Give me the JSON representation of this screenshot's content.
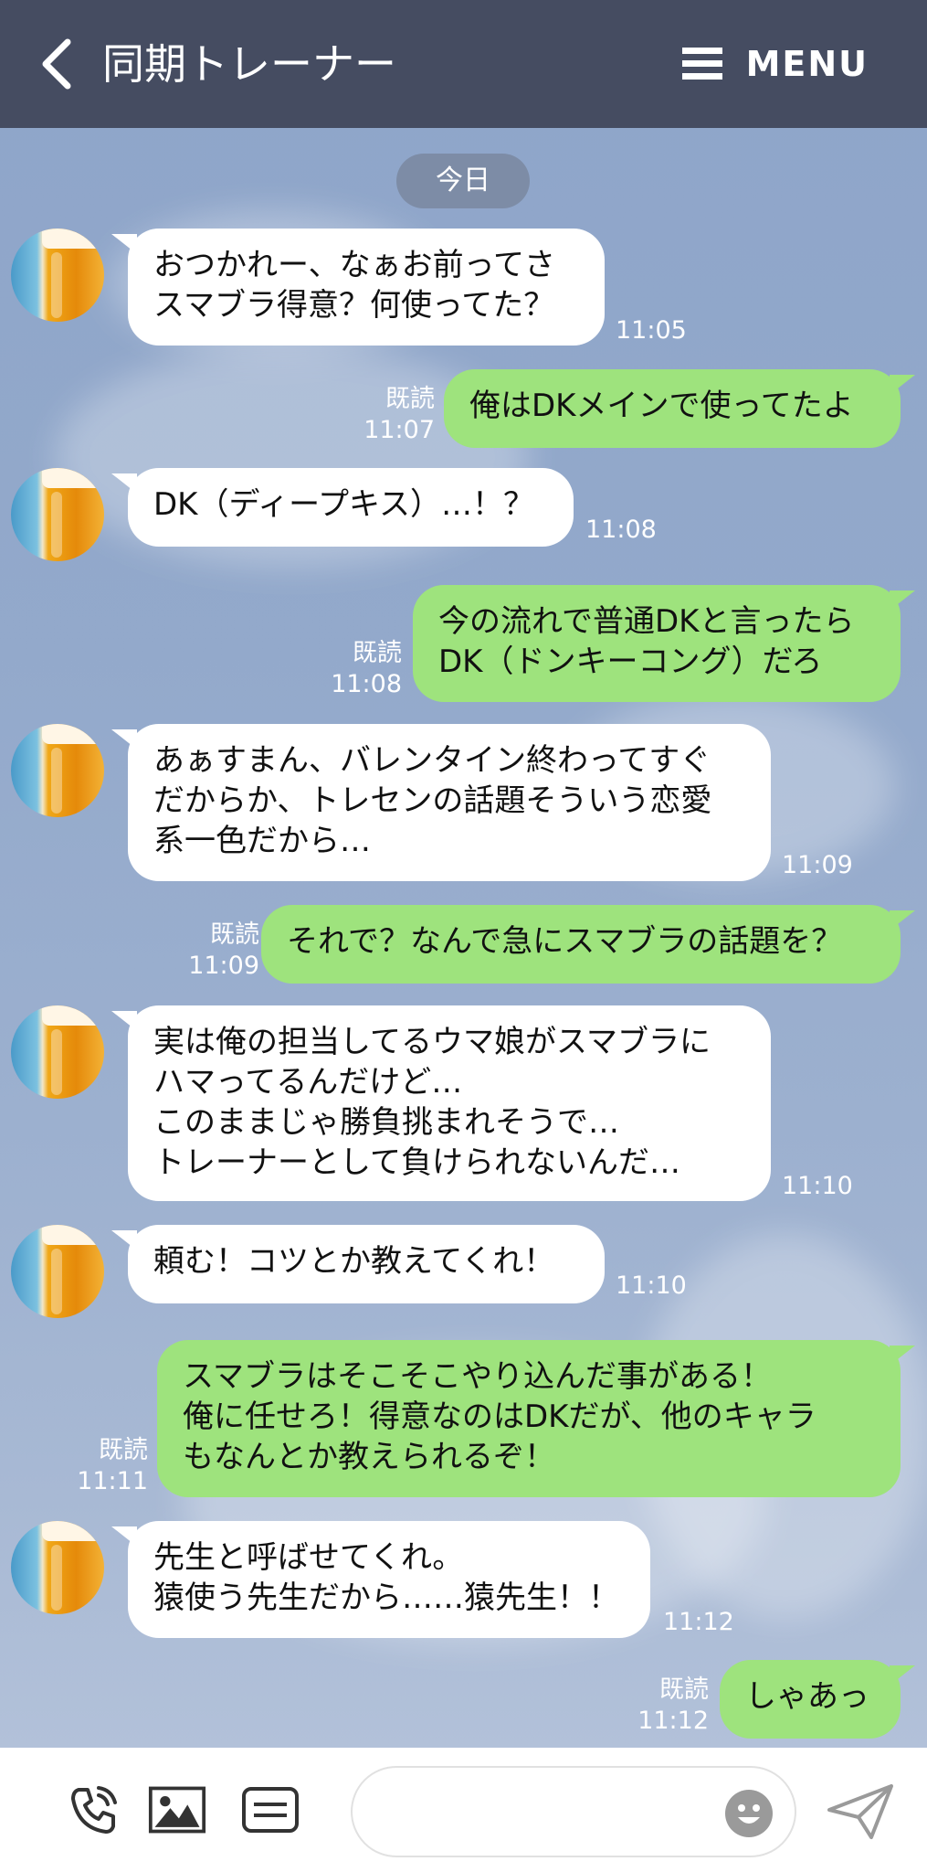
{
  "header": {
    "title": "同期トレーナー",
    "menu_label": "MENU"
  },
  "date_divider": "今日",
  "colors": {
    "header_bg": "#454c61",
    "my_bubble": "#9ee37d",
    "their_bubble": "#ffffff"
  },
  "messages": [
    {
      "from": "them",
      "text": "おつかれー、なぁお前ってさ\nスマブラ得意？何使ってた？",
      "time": "11:05"
    },
    {
      "from": "me",
      "text": "俺はDKメインで使ってたよ",
      "read": "既読",
      "time": "11:07"
    },
    {
      "from": "them",
      "text": "DK（ディープキス）…！？",
      "time": "11:08"
    },
    {
      "from": "me",
      "text": "今の流れで普通DKと言ったら\nDK（ドンキーコング）だろ",
      "read": "既読",
      "time": "11:08"
    },
    {
      "from": "them",
      "text": "あぁすまん、バレンタイン終わってすぐ\nだからか、トレセンの話題そういう恋愛\n系一色だから…",
      "time": "11:09"
    },
    {
      "from": "me",
      "text": "それで？なんで急にスマブラの話題を？",
      "read": "既読",
      "time": "11:09"
    },
    {
      "from": "them",
      "text": "実は俺の担当してるウマ娘がスマブラに\nハマってるんだけど…\nこのままじゃ勝負挑まれそうで…\nトレーナーとして負けられないんだ…",
      "time": "11:10"
    },
    {
      "from": "them",
      "text": "頼む！コツとか教えてくれ！",
      "time": "11:10"
    },
    {
      "from": "me",
      "text": "スマブラはそこそこやり込んだ事がある！\n俺に任せろ！得意なのはDKだが、他のキャラ\nもなんとか教えられるぞ！",
      "read": "既読",
      "time": "11:11"
    },
    {
      "from": "them",
      "text": "先生と呼ばせてくれ。\n猿使う先生だから……猿先生！！",
      "time": "11:12"
    },
    {
      "from": "me",
      "text": "しゃあっ",
      "read": "既読",
      "time": "11:12"
    }
  ],
  "footer": {
    "input_placeholder": "",
    "icons": [
      "phone-icon",
      "image-icon",
      "keyboard-icon",
      "emoji-icon",
      "send-icon"
    ]
  }
}
